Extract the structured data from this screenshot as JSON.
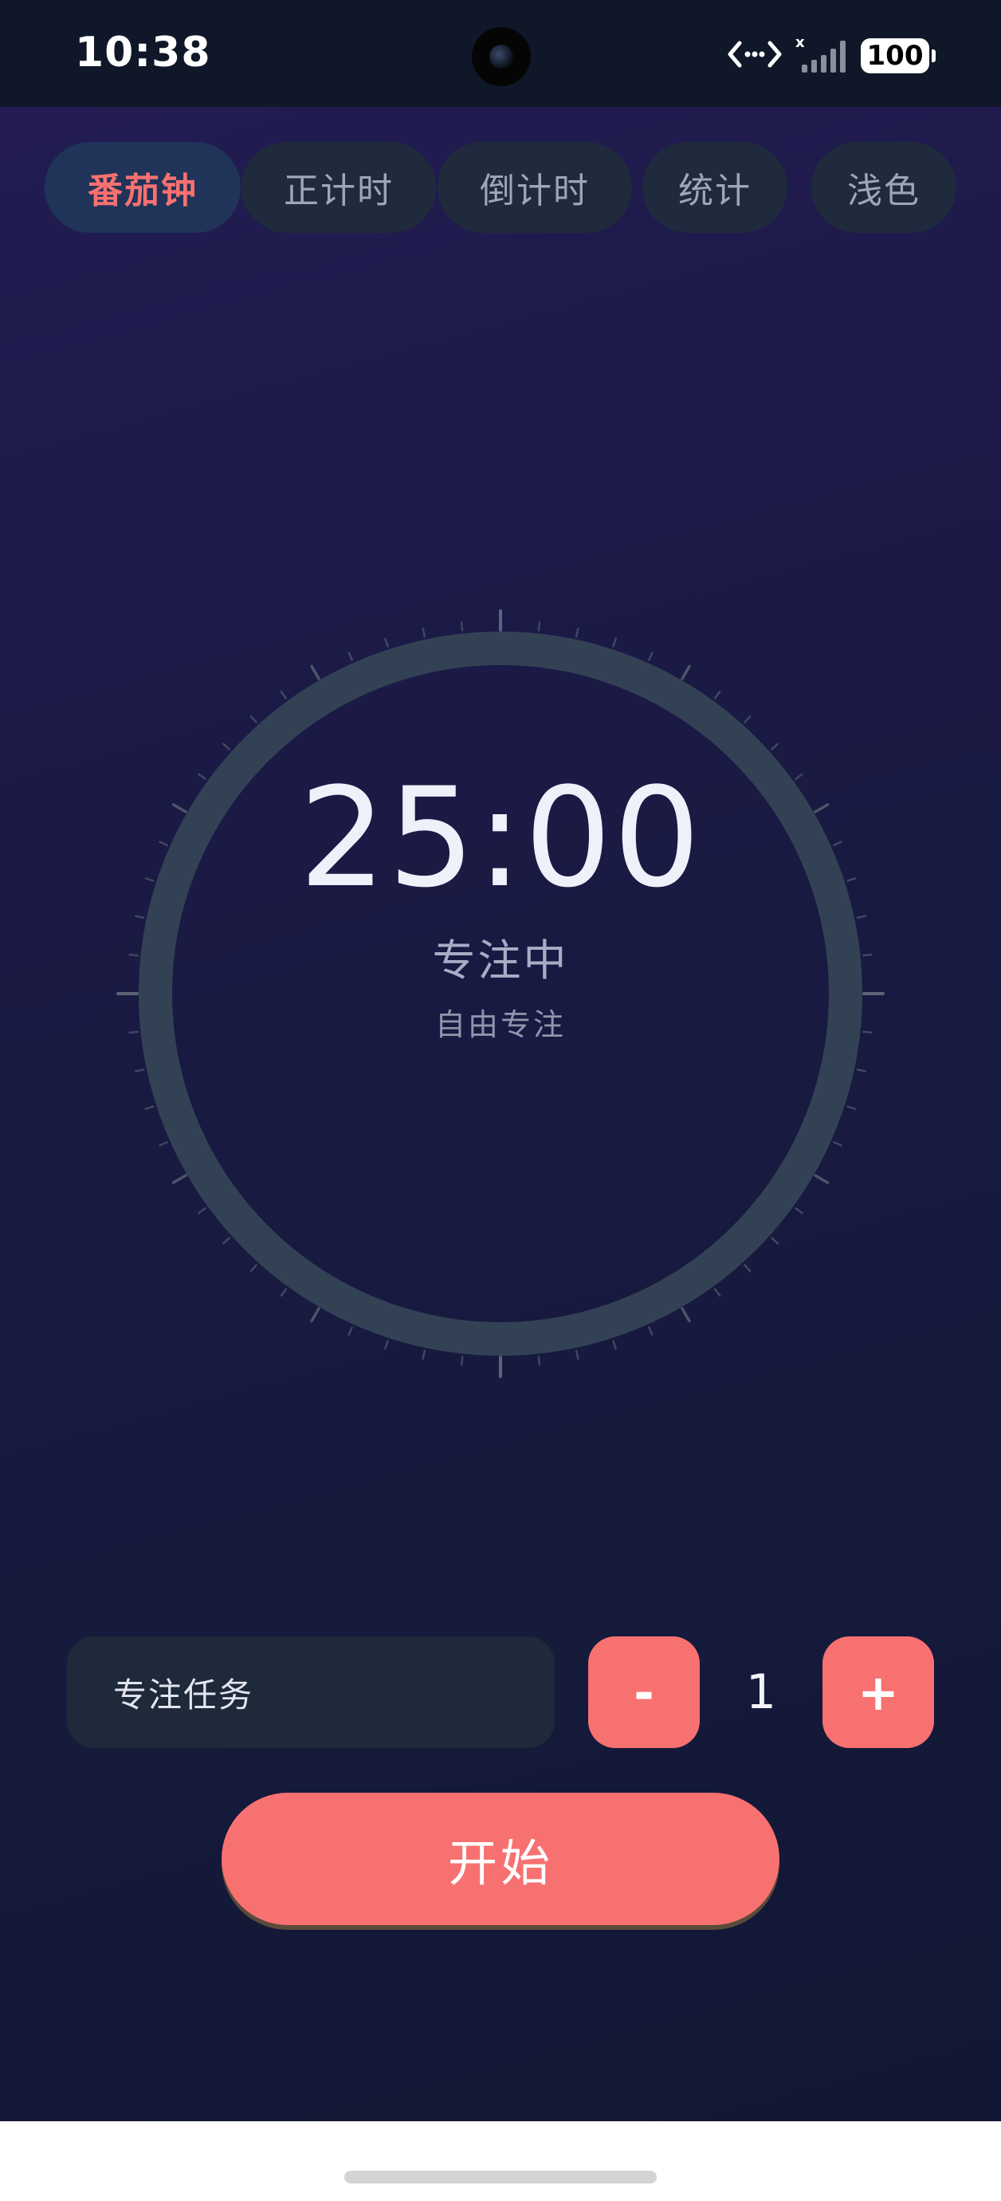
{
  "status_bar": {
    "time": "10:38",
    "battery": "100"
  },
  "tabs": [
    {
      "label": "番茄钟",
      "active": true
    },
    {
      "label": "正计时",
      "active": false
    },
    {
      "label": "倒计时",
      "active": false
    },
    {
      "label": "统计",
      "active": false
    },
    {
      "label": "浅色",
      "active": false
    }
  ],
  "timer": {
    "display": "25:00",
    "status": "专注中",
    "mode": "自由专注",
    "progress": 0
  },
  "task": {
    "placeholder": "专注任务"
  },
  "stepper": {
    "minus_label": "-",
    "count": "1",
    "plus_label": "+"
  },
  "start_button": {
    "label": "开始"
  },
  "colors": {
    "accent": "#f87171",
    "ring": "#334155",
    "tab_bg": "#1f2a3d",
    "tab_active_bg": "#203459",
    "background_top": "#221c52",
    "background_bottom": "#121733"
  }
}
